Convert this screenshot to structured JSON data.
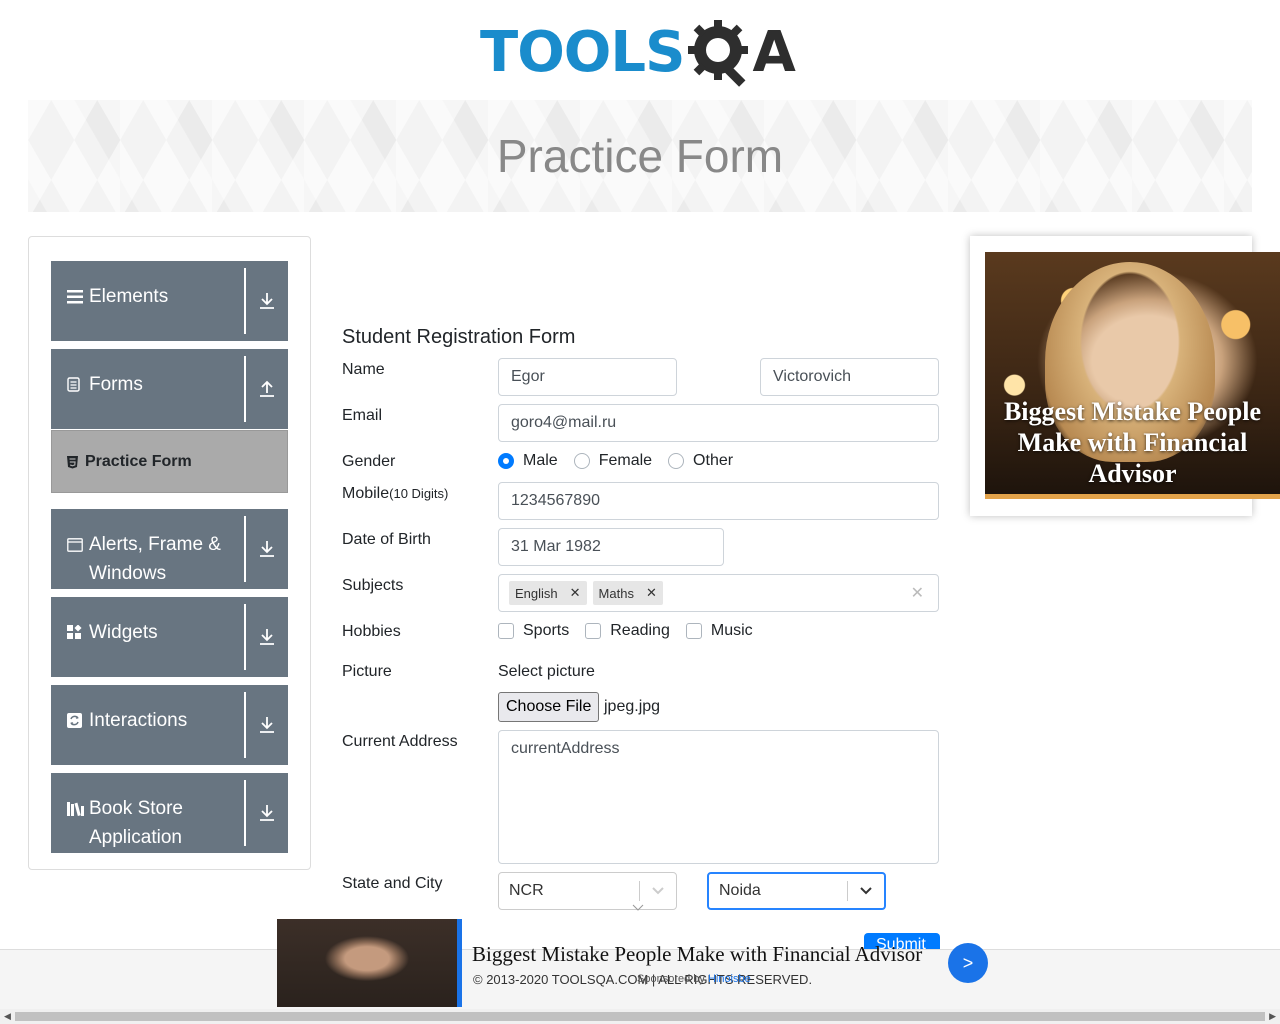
{
  "header": {
    "logo_tools": "TOOLS",
    "logo_a": "A"
  },
  "banner": {
    "title": "Practice Form"
  },
  "sidebar": {
    "groups": [
      {
        "label": "Elements",
        "icon": "hamburger-icon",
        "arrow": "download-arrow-icon"
      },
      {
        "label": "Forms",
        "icon": "document-icon",
        "arrow": "upload-arrow-icon"
      },
      {
        "label": "Alerts, Frame & Windows",
        "icon": "window-icon",
        "arrow": "download-arrow-icon"
      },
      {
        "label": "Widgets",
        "icon": "widgets-icon",
        "arrow": "download-arrow-icon"
      },
      {
        "label": "Interactions",
        "icon": "interactions-icon",
        "arrow": "download-arrow-icon"
      },
      {
        "label": "Book Store Application",
        "icon": "books-icon",
        "arrow": "download-arrow-icon"
      }
    ],
    "active_item": "Practice Form"
  },
  "form": {
    "title": "Student Registration Form",
    "name_label": "Name",
    "first_name": "Egor",
    "last_name": "Victorovich",
    "email_label": "Email",
    "email": "goro4@mail.ru",
    "gender_label": "Gender",
    "gender_options": [
      "Male",
      "Female",
      "Other"
    ],
    "gender_selected": "Male",
    "mobile_label": "Mobile",
    "mobile_hint": "(10 Digits)",
    "mobile": "1234567890",
    "dob_label": "Date of Birth",
    "dob": "31 Mar 1982",
    "subjects_label": "Subjects",
    "subjects": [
      "English",
      "Maths"
    ],
    "hobbies_label": "Hobbies",
    "hobbies": [
      "Sports",
      "Reading",
      "Music"
    ],
    "picture_label": "Picture",
    "picture_prompt": "Select picture",
    "choose_file": "Choose File",
    "file_name": "jpeg.jpg",
    "address_label": "Current Address",
    "address": "currentAddress",
    "state_city_label": "State and City",
    "state": "NCR",
    "city": "Noida",
    "submit": "Submit"
  },
  "ad_side": {
    "text": "Biggest Mistake People Make with Financial Advisor"
  },
  "ad_bottom": {
    "title": "Biggest Mistake People Make with Financial Advisor",
    "sponsor_prefix": "Sponsored by ",
    "sponsor": "Hinoisbe",
    "next": ">"
  },
  "footer": {
    "copyright": "© 2013-2020 TOOLSQA.COM | ALL RIGHTS RESERVED."
  },
  "colors": {
    "accent": "#007bff",
    "sidebar": "#687581",
    "logo_blue": "#1a8ccc"
  }
}
